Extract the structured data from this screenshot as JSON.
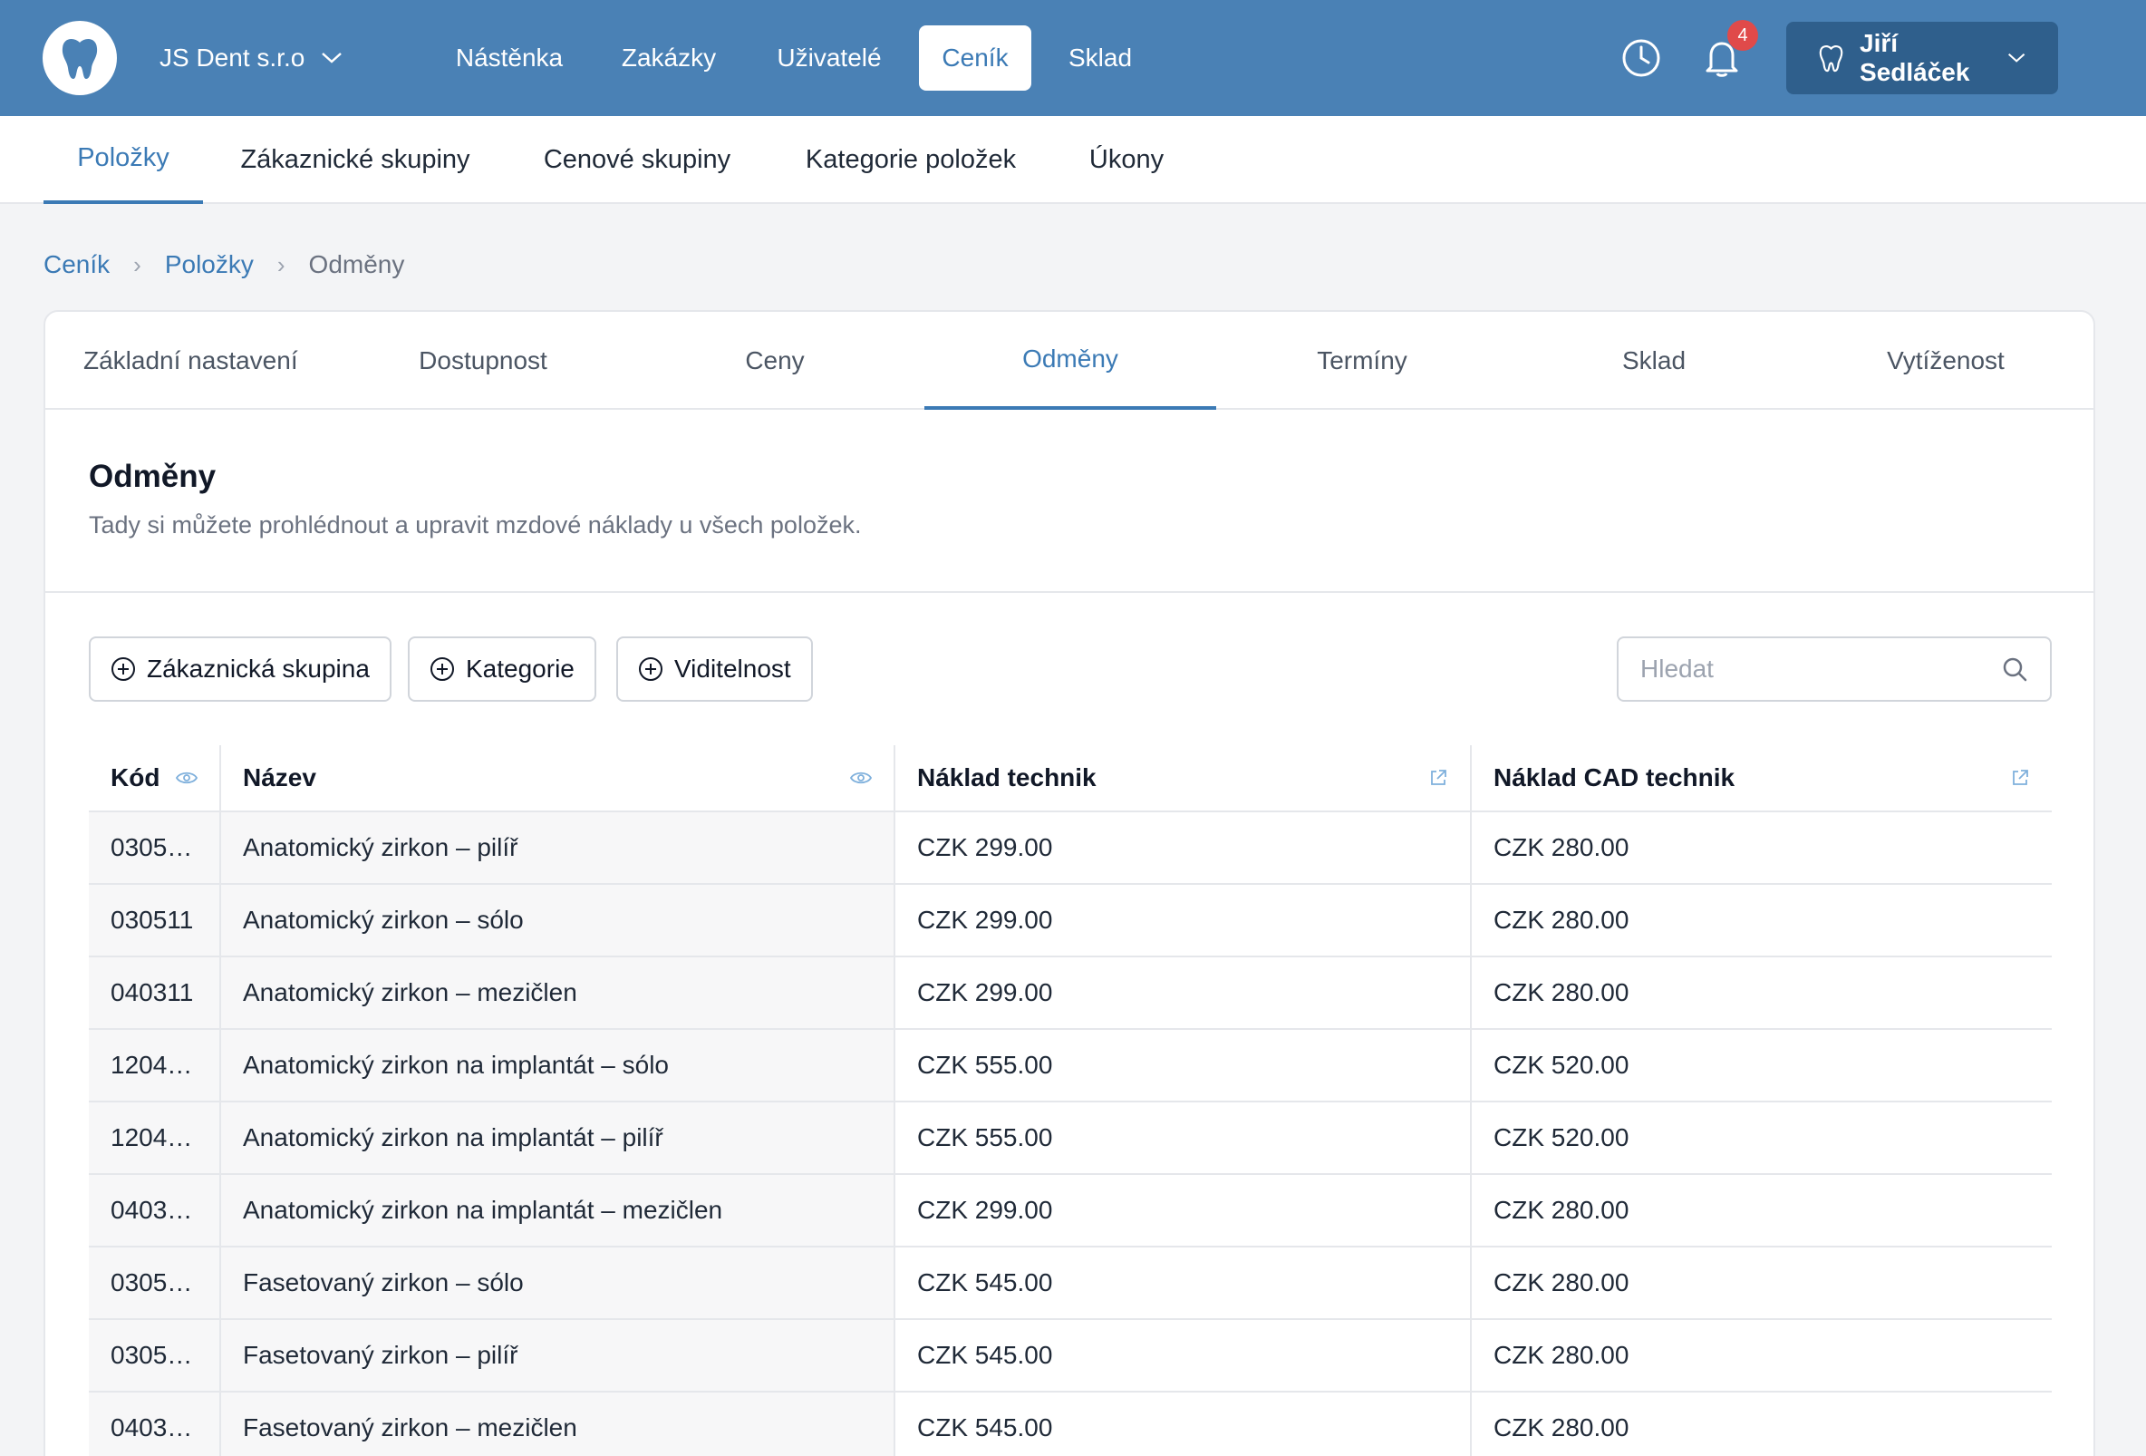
{
  "header": {
    "company": "JS Dent s.r.o",
    "nav": [
      {
        "label": "Nástěnka",
        "active": false
      },
      {
        "label": "Zakázky",
        "active": false
      },
      {
        "label": "Uživatelé",
        "active": false
      },
      {
        "label": "Ceník",
        "active": true
      },
      {
        "label": "Sklad",
        "active": false
      }
    ],
    "notifications_count": "4",
    "user_name": "Jiří Sedláček",
    "icons": {
      "logo": "tooth-icon",
      "history": "clock-icon",
      "notifications": "bell-icon"
    }
  },
  "subnav": {
    "tabs": [
      {
        "label": "Položky",
        "active": true
      },
      {
        "label": "Zákaznické skupiny",
        "active": false
      },
      {
        "label": "Cenové skupiny",
        "active": false
      },
      {
        "label": "Kategorie položek",
        "active": false
      },
      {
        "label": "Úkony",
        "active": false
      }
    ]
  },
  "breadcrumb": {
    "items": [
      "Ceník",
      "Položky",
      "Odměny"
    ]
  },
  "card": {
    "tabs": [
      {
        "label": "Základní nastavení",
        "active": false
      },
      {
        "label": "Dostupnost",
        "active": false
      },
      {
        "label": "Ceny",
        "active": false
      },
      {
        "label": "Odměny",
        "active": true
      },
      {
        "label": "Termíny",
        "active": false
      },
      {
        "label": "Sklad",
        "active": false
      },
      {
        "label": "Vytíženost",
        "active": false
      }
    ],
    "title": "Odměny",
    "description": "Tady si můžete prohlédnout a upravit mzdové náklady u všech položek."
  },
  "filters": {
    "buttons": [
      "Zákaznická skupina",
      "Kategorie",
      "Viditelnost"
    ],
    "search_placeholder": "Hledat"
  },
  "table": {
    "headers": [
      "Kód",
      "Název",
      "Náklad technik",
      "Náklad CAD technik"
    ],
    "rows": [
      {
        "code": "0305…",
        "name": "Anatomický zirkon – pilíř",
        "tech": "CZK 299.00",
        "cad": "CZK 280.00"
      },
      {
        "code": "030511",
        "name": "Anatomický zirkon – sólo",
        "tech": "CZK 299.00",
        "cad": "CZK 280.00"
      },
      {
        "code": "040311",
        "name": "Anatomický zirkon – mezičlen",
        "tech": "CZK 299.00",
        "cad": "CZK 280.00"
      },
      {
        "code": "1204…",
        "name": "Anatomický zirkon na implantát – sólo",
        "tech": "CZK 555.00",
        "cad": "CZK 520.00"
      },
      {
        "code": "1204…",
        "name": "Anatomický zirkon na implantát – pilíř",
        "tech": "CZK 555.00",
        "cad": "CZK 520.00"
      },
      {
        "code": "0403…",
        "name": "Anatomický zirkon na implantát – mezičlen",
        "tech": "CZK 299.00",
        "cad": "CZK 280.00"
      },
      {
        "code": "0305…",
        "name": "Fasetovaný zirkon – sólo",
        "tech": "CZK 545.00",
        "cad": "CZK 280.00"
      },
      {
        "code": "0305…",
        "name": "Fasetovaný zirkon – pilíř",
        "tech": "CZK 545.00",
        "cad": "CZK 280.00"
      },
      {
        "code": "0403…",
        "name": "Fasetovaný zirkon – mezičlen",
        "tech": "CZK 545.00",
        "cad": "CZK 280.00"
      }
    ]
  },
  "colors": {
    "header_bg": "#4a81b5",
    "accent": "#3b7ab5",
    "user_button_bg": "#2f5f8c",
    "badge": "#e04a4a"
  }
}
